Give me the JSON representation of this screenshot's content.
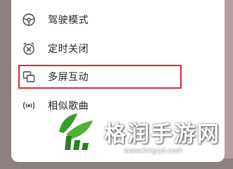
{
  "menu": {
    "items": [
      {
        "label": "驾驶模式",
        "icon": "steering-wheel-icon"
      },
      {
        "label": "定时关闭",
        "icon": "alarm-clock-icon"
      },
      {
        "label": "多屏互动",
        "icon": "multi-screen-icon",
        "highlighted": true
      },
      {
        "label": "相似歌曲",
        "icon": "sound-wave-icon"
      }
    ]
  },
  "watermark": {
    "text": "格润手游网",
    "url": "www.hngrjd.com"
  },
  "colors": {
    "panel": "#ffffff",
    "backdrop": "#8e7f7f",
    "highlight_border": "#e0262b",
    "logo_green": "#3a9a2c"
  }
}
